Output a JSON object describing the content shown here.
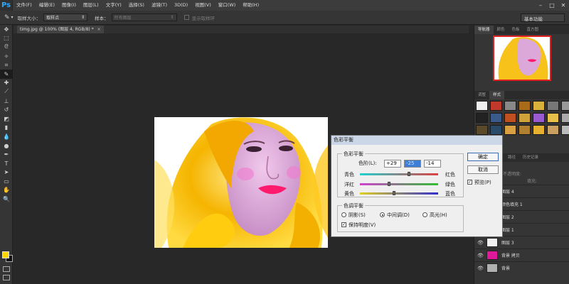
{
  "app": {
    "logo": "Ps"
  },
  "menu": [
    "文件(F)",
    "编辑(E)",
    "图像(I)",
    "图层(L)",
    "文字(Y)",
    "选择(S)",
    "滤镜(T)",
    "3D(D)",
    "视图(V)",
    "窗口(W)",
    "帮助(H)"
  ],
  "window_controls": [
    "–",
    "□",
    "✕"
  ],
  "options_bar": {
    "sample_size_label": "取样大小：",
    "sample_size_value": "取样点",
    "sample_label": "样本：",
    "sample_value": "所有图层",
    "show_ring_label": "显示取样环",
    "workspace": "基本功能"
  },
  "document": {
    "tab_title": "timg.jpg @ 100% (图层 4, RGB/8) *"
  },
  "navigator_tabs": [
    "导航器",
    "颜色",
    "色板",
    "直方图"
  ],
  "styles_tabs": [
    "调整",
    "样式"
  ],
  "layers_tabs": [
    "图层",
    "通道",
    "路径",
    "历史记录"
  ],
  "layers_controls": {
    "opacity_label": "不透明度:",
    "fill_label": "填充:"
  },
  "layers": [
    {
      "name": "图层 4",
      "visible": false,
      "thumb": "#9a9a9a"
    },
    {
      "name": "颜色填充 1",
      "visible": false,
      "thumb": "#ffffff"
    },
    {
      "name": "图层 2",
      "visible": false,
      "thumb": "#8a8a8a"
    },
    {
      "name": "图层 1",
      "visible": false,
      "thumb": "#8a8a8a"
    },
    {
      "name": "图层 3",
      "visible": true,
      "thumb": "#f0f0f0"
    },
    {
      "name": "背景 拷贝",
      "visible": true,
      "thumb": "#e0199a"
    },
    {
      "name": "背景",
      "visible": true,
      "thumb": "#b0b0b0"
    }
  ],
  "dialog": {
    "title": "色彩平衡",
    "group1_label": "色彩平衡",
    "levels_label": "色阶(L):",
    "levels": [
      "+29",
      "-25",
      "-14"
    ],
    "rows": [
      {
        "left": "青色",
        "right": "红色",
        "value": 0.63
      },
      {
        "left": "洋红",
        "right": "绿色",
        "value": 0.37
      },
      {
        "left": "黄色",
        "right": "蓝色",
        "value": 0.43
      }
    ],
    "group2_label": "色调平衡",
    "radios": [
      "阴影(S)",
      "中间调(D)",
      "高光(H)"
    ],
    "selected_radio": 1,
    "preserve_luminosity": "保持明度(V)",
    "ok": "确定",
    "cancel": "取消",
    "preview": "预览(P)"
  },
  "colors": {
    "foreground": "#ffd700",
    "background": "#111111",
    "accent": "#31a8ff"
  }
}
